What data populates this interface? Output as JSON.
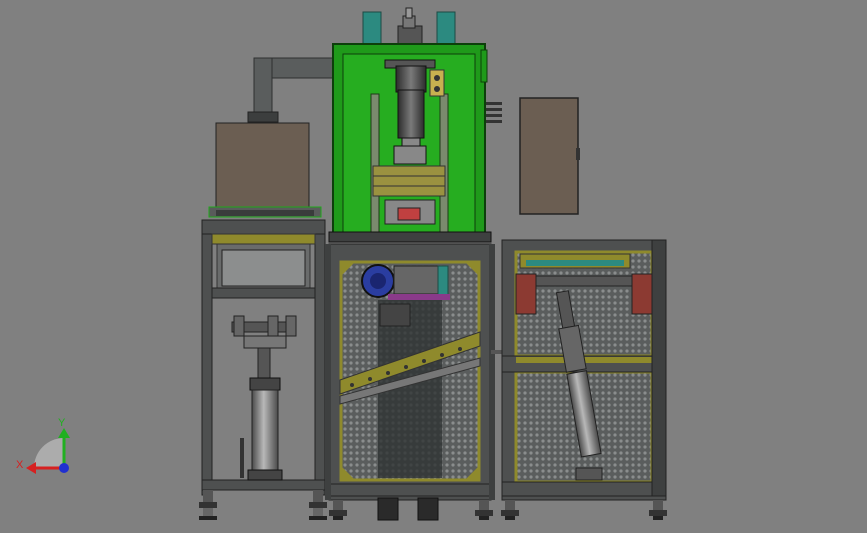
{
  "viewport": {
    "background": "#808080"
  },
  "triad": {
    "x_label": "X",
    "y_label": "Y",
    "x_color": "#d62020",
    "y_color": "#20b020",
    "z_color": "#2030d0"
  },
  "colors": {
    "frame": "#4e5050",
    "frame_light": "#6a6c6c",
    "green_enclosure": "#22a81e",
    "green_dark": "#137010",
    "brown_box": "#6b5e52",
    "olive": "#8f8a2c",
    "teal_stack": "#2c8a80",
    "cylinder": "#888",
    "blue_motor": "#2a3da0",
    "maroon_bracket": "#8c3a32",
    "mesh": "#5c5f5f"
  }
}
